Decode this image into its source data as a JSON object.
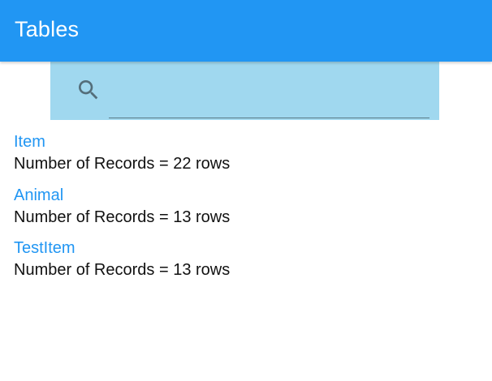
{
  "appbar": {
    "title": "Tables",
    "color": "#2196f3"
  },
  "search": {
    "icon": "search-icon",
    "value": "",
    "placeholder": "",
    "background": "#a0d8ef"
  },
  "tables": [
    {
      "name": "Item",
      "records": "Number of Records = 22 rows"
    },
    {
      "name": "Animal",
      "records": "Number of Records = 13 rows"
    },
    {
      "name": "TestItem",
      "records": "Number of Records = 13 rows"
    }
  ]
}
